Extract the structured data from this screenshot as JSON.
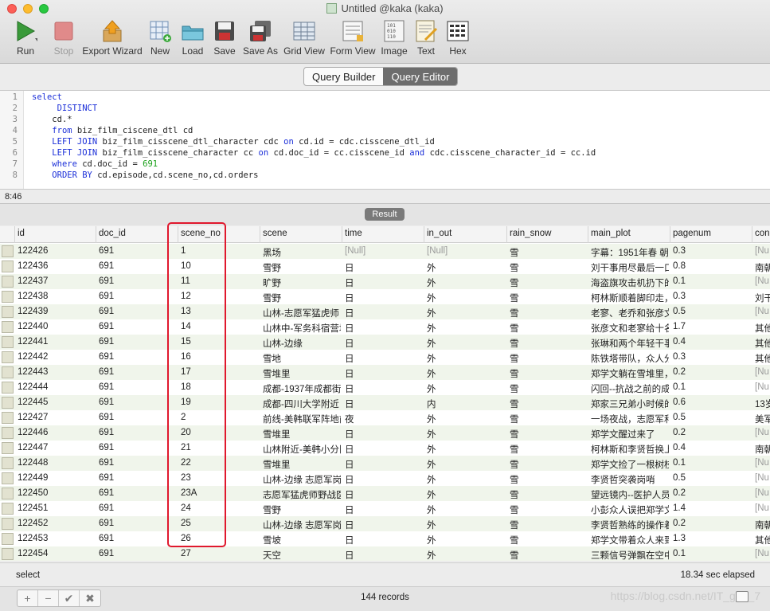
{
  "window": {
    "title": "Untitled @kaka (kaka)"
  },
  "toolbar": [
    {
      "label": "Run",
      "icon": "play-icon"
    },
    {
      "label": "Stop",
      "icon": "stop-icon",
      "disabled": true
    },
    {
      "label": "Export Wizard",
      "icon": "export-icon"
    },
    {
      "label": "New",
      "icon": "new-table-icon"
    },
    {
      "label": "Load",
      "icon": "load-folder-icon"
    },
    {
      "label": "Save",
      "icon": "save-disk-icon"
    },
    {
      "label": "Save As",
      "icon": "save-as-icon"
    },
    {
      "label": "Grid View",
      "icon": "grid-view-icon"
    },
    {
      "label": "Form View",
      "icon": "form-view-icon"
    },
    {
      "label": "Image",
      "icon": "binary-image-icon"
    },
    {
      "label": "Text",
      "icon": "text-icon"
    },
    {
      "label": "Hex",
      "icon": "hex-icon"
    }
  ],
  "tabs": {
    "builder": "Query Builder",
    "editor": "Query Editor"
  },
  "editor": {
    "lines": [
      {
        "n": "1",
        "t": "select"
      },
      {
        "n": "2",
        "t": "     DISTINCT"
      },
      {
        "n": "3",
        "t": "    cd.*"
      },
      {
        "n": "4",
        "t": "    from biz_film_ciscene_dtl cd"
      },
      {
        "n": "5",
        "t": "    LEFT JOIN biz_film_cisscene_dtl_character cdc on cd.id = cdc.cisscene_dtl_id"
      },
      {
        "n": "6",
        "t": "    LEFT JOIN biz_film_cisscene_character cc on cd.doc_id = cc.cisscene_id and cdc.cisscene_character_id = cc.id"
      },
      {
        "n": "7",
        "t": "    where cd.doc_id = 691"
      },
      {
        "n": "8",
        "t": "    ORDER BY cd.episode,cd.scene_no,cd.orders"
      }
    ],
    "cursor": "8:46"
  },
  "result_label": "Result",
  "columns": [
    "id",
    "doc_id",
    "scene_no",
    "scene",
    "time",
    "in_out",
    "rain_snow",
    "main_plot",
    "pagenum",
    "con"
  ],
  "rows": [
    [
      "122426",
      "691",
      "1",
      "黑场",
      "[Null]",
      "[Null]",
      "雪",
      "字幕：1951年春 朝",
      "0.3",
      "[Nu"
    ],
    [
      "122436",
      "691",
      "10",
      "雪野",
      "日",
      "外",
      "雪",
      "刘干事用尽最后一口",
      "0.8",
      "南朝"
    ],
    [
      "122437",
      "691",
      "11",
      "旷野",
      "日",
      "外",
      "雪",
      "海盗旗攻击机扔下的",
      "0.1",
      "[Nu"
    ],
    [
      "122438",
      "691",
      "12",
      "雪野",
      "日",
      "外",
      "雪",
      "柯林斯顺着脚印走，",
      "0.3",
      "刘干"
    ],
    [
      "122439",
      "691",
      "13",
      "山林-志愿军猛虎师",
      "日",
      "外",
      "雪",
      "老寥、老乔和张彦文",
      "0.5",
      "[Nu"
    ],
    [
      "122440",
      "691",
      "14",
      "山林中-军务科宿营地",
      "日",
      "外",
      "雪",
      "张彦文和老寥给十名",
      "1.7",
      "其他"
    ],
    [
      "122441",
      "691",
      "15",
      "山林-边缘",
      "日",
      "外",
      "雪",
      "张琳和两个年轻干事",
      "0.4",
      "其他"
    ],
    [
      "122442",
      "691",
      "16",
      "雪地",
      "日",
      "外",
      "雪",
      "陈铁塔带队，众人分",
      "0.3",
      "其他"
    ],
    [
      "122443",
      "691",
      "17",
      "雪堆里",
      "日",
      "外",
      "雪",
      "郑学文躺在雪堆里，",
      "0.2",
      "[Nu"
    ],
    [
      "122444",
      "691",
      "18",
      "成都-1937年成都街",
      "日",
      "外",
      "雪",
      "闪回--抗战之前的成",
      "0.1",
      "[Nu"
    ],
    [
      "122445",
      "691",
      "19",
      "成都-四川大学附近",
      "日",
      "内",
      "雪",
      "郑家三兄弟小时候的",
      "0.6",
      "13岁"
    ],
    [
      "122427",
      "691",
      "2",
      "前线-美韩联军阵地前",
      "夜",
      "外",
      "雪",
      "一场夜战，志愿军和",
      "0.5",
      "美军"
    ],
    [
      "122446",
      "691",
      "20",
      "雪堆里",
      "日",
      "外",
      "雪",
      "郑学文醒过来了",
      "0.2",
      "[Nu"
    ],
    [
      "122447",
      "691",
      "21",
      "山林附近-美韩小分队",
      "日",
      "外",
      "雪",
      "柯林斯和李贤哲换上",
      "0.4",
      "南朝"
    ],
    [
      "122448",
      "691",
      "22",
      "雪堆里",
      "日",
      "外",
      "雪",
      "郑学文捡了一根树枝",
      "0.1",
      "[Nu"
    ],
    [
      "122449",
      "691",
      "23",
      "山林-边缘 志愿军岗",
      "日",
      "外",
      "雪",
      "李贤哲突袭岗哨",
      "0.5",
      "[Nu"
    ],
    [
      "122450",
      "691",
      "23A",
      "志愿军猛虎师野战医",
      "日",
      "外",
      "雪",
      "望远镜内--医护人员",
      "0.2",
      "[Nu"
    ],
    [
      "122451",
      "691",
      "24",
      "雪野",
      "日",
      "外",
      "雪",
      "小彭众人误把郑学文",
      "1.4",
      "[Nu"
    ],
    [
      "122452",
      "691",
      "25",
      "山林-边缘 志愿军岗",
      "日",
      "外",
      "雪",
      "李贤哲熟练的操作着",
      "0.2",
      "南朝"
    ],
    [
      "122453",
      "691",
      "26",
      "雪坡",
      "日",
      "外",
      "雪",
      "郑学文带着众人来到",
      "1.3",
      "其他"
    ],
    [
      "122454",
      "691",
      "27",
      "天空",
      "日",
      "外",
      "雪",
      "三颗信号弹飘在空中",
      "0.1",
      "[Nu"
    ]
  ],
  "status": {
    "query": "select",
    "elapsed": "18.34 sec elapsed",
    "records": "144 records"
  },
  "footer_buttons": [
    "+",
    "−",
    "✔",
    "✖"
  ],
  "watermark": "https://blog.csdn.net/IT_g___7",
  "colors": {
    "highlight_box": "#e0182d",
    "keyword": "#1a2ed8",
    "number": "#19a119",
    "alt_row": "#f0f5eb"
  }
}
